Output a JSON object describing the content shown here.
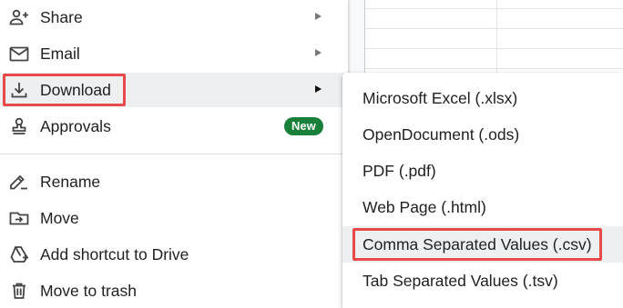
{
  "menu": {
    "items": [
      {
        "label": "Share"
      },
      {
        "label": "Email"
      },
      {
        "label": "Download"
      },
      {
        "label": "Approvals",
        "badge": "New"
      },
      {
        "label": "Rename"
      },
      {
        "label": "Move"
      },
      {
        "label": "Add shortcut to Drive"
      },
      {
        "label": "Move to trash"
      }
    ]
  },
  "download_submenu": {
    "items": [
      {
        "label": "Microsoft Excel (.xlsx)"
      },
      {
        "label": "OpenDocument (.ods)"
      },
      {
        "label": "PDF (.pdf)"
      },
      {
        "label": "Web Page (.html)"
      },
      {
        "label": "Comma Separated Values (.csv)"
      },
      {
        "label": "Tab Separated Values (.tsv)"
      }
    ]
  },
  "colors": {
    "highlight_box": "#e84a4a",
    "new_badge": "#188038",
    "hover_background": "#eeeff1"
  },
  "icons": {
    "share": "person-add-icon",
    "email": "envelope-icon",
    "download": "download-icon",
    "approvals": "stamp-icon",
    "rename": "pencil-icon",
    "move": "folder-move-icon",
    "shortcut": "add-to-drive-icon",
    "trash": "trash-icon"
  }
}
